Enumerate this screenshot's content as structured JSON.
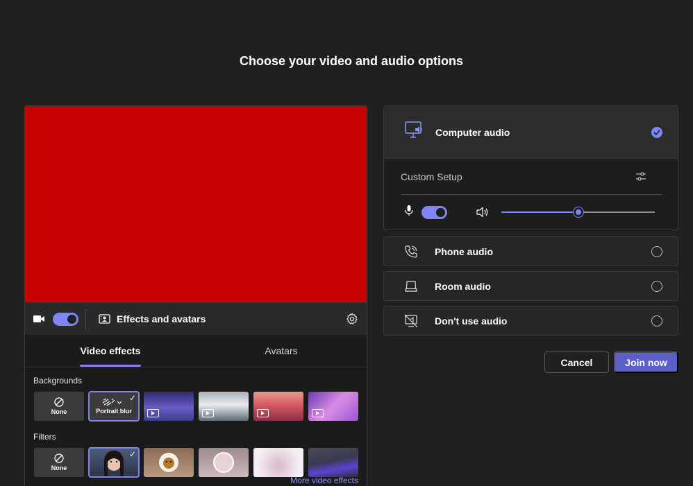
{
  "page": {
    "title": "Choose your video and audio options"
  },
  "video": {
    "camera_on": true,
    "effects_label": "Effects and avatars",
    "tabs": [
      {
        "label": "Video effects",
        "active": true
      },
      {
        "label": "Avatars",
        "active": false
      }
    ],
    "backgrounds_label": "Backgrounds",
    "backgrounds": [
      {
        "label": "None",
        "kind": "none"
      },
      {
        "label": "Portrait blur",
        "kind": "blur",
        "selected": true
      },
      {
        "label": "",
        "kind": "video",
        "colors": [
          "#3a3f86",
          "#8b7ad6"
        ]
      },
      {
        "label": "",
        "kind": "video",
        "colors": [
          "#5e6c7a",
          "#d8dde3"
        ]
      },
      {
        "label": "",
        "kind": "video",
        "colors": [
          "#d8616b",
          "#f3b39a"
        ]
      },
      {
        "label": "",
        "kind": "video",
        "colors": [
          "#8d52c9",
          "#e9a2ee"
        ]
      }
    ],
    "filters_label": "Filters",
    "filters": [
      {
        "label": "None",
        "kind": "none"
      },
      {
        "label": "",
        "kind": "portrait",
        "selected": true
      },
      {
        "label": "",
        "kind": "sticker",
        "colors": [
          "#7a5a3e",
          "#c59a78"
        ]
      },
      {
        "label": "",
        "kind": "frame",
        "colors": [
          "#8f7c7e",
          "#c9b3b3"
        ]
      },
      {
        "label": "",
        "kind": "soft",
        "colors": [
          "#f4eff2",
          "#d2b6c9"
        ]
      },
      {
        "label": "",
        "kind": "wave",
        "colors": [
          "#3c3c55",
          "#6a4dd9"
        ]
      }
    ],
    "more_effects_link": "More video effects"
  },
  "audio": {
    "computer_audio": {
      "label": "Computer audio",
      "selected": true
    },
    "custom_setup_label": "Custom Setup",
    "mic_on": true,
    "speaker_volume_fraction": 0.5,
    "options": [
      {
        "label": "Phone audio",
        "icon": "phone-icon"
      },
      {
        "label": "Room audio",
        "icon": "room-icon"
      },
      {
        "label": "Don't use audio",
        "icon": "no-audio-icon"
      }
    ]
  },
  "actions": {
    "cancel": "Cancel",
    "join": "Join now"
  },
  "colors": {
    "accent": "#7f85f5",
    "primary_button": "#5b5fc7",
    "preview": "#c60000"
  }
}
